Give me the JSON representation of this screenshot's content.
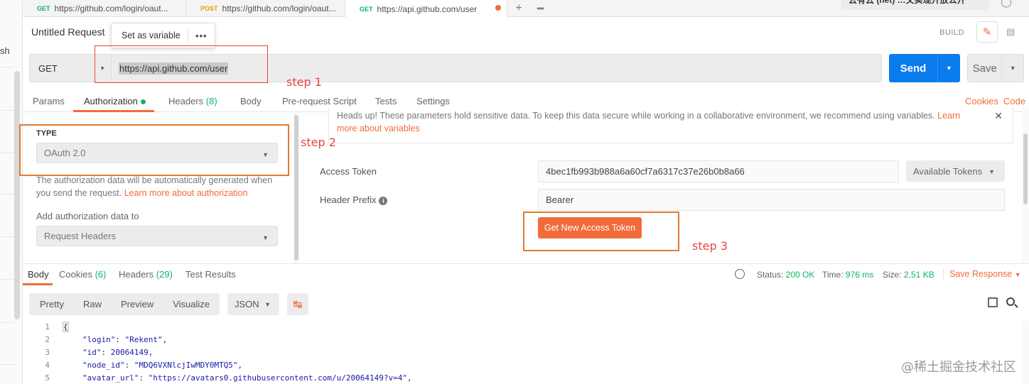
{
  "tabs": [
    {
      "method": "GET",
      "url": "https://github.com/login/oaut..."
    },
    {
      "method": "POST",
      "url": "https://github.com/login/oaut..."
    },
    {
      "method": "GET",
      "url": "https://api.github.com/user"
    }
  ],
  "left_sidebar": {
    "fragment": "sh"
  },
  "environment": {
    "label": "云有云 (net) …文实现开放公开"
  },
  "request": {
    "name": "Untitled Request",
    "method": "GET",
    "url": "https://api.github.com/user",
    "build_label": "BUILD",
    "send_label": "Send",
    "save_label": "Save"
  },
  "popup": {
    "set_as_variable": "Set as variable",
    "more": "•••"
  },
  "annotations": {
    "step1": "step 1",
    "step2": "step 2",
    "step3": "step 3"
  },
  "request_tabs": {
    "params": "Params",
    "authorization": "Authorization",
    "headers": "Headers",
    "headers_count": "(8)",
    "body": "Body",
    "prerequest": "Pre-request Script",
    "tests": "Tests",
    "settings": "Settings",
    "cookies": "Cookies",
    "code": "Code"
  },
  "auth": {
    "type_label": "TYPE",
    "type_value": "OAuth 2.0",
    "description": "The authorization data will be automatically generated when you send the request.",
    "learn_more": "Learn more about authorization",
    "add_to_label": "Add authorization data to",
    "add_to_value": "Request Headers",
    "heads_up": "Heads up! These parameters hold sensitive data. To keep this data secure while working in a collaborative environment, we recommend using variables.",
    "learn_more_vars_1": "Learn more",
    "learn_more_vars_2": "about variables",
    "access_token_label": "Access Token",
    "access_token_value": "4bec1fb993b988a6a60cf7a6317c37e26b0b8a66",
    "available_tokens": "Available Tokens",
    "header_prefix_label": "Header Prefix",
    "header_prefix_value": "Bearer",
    "get_token_button": "Get New Access Token"
  },
  "response": {
    "tabs": {
      "body": "Body",
      "cookies": "Cookies",
      "cookies_count": "(6)",
      "headers": "Headers",
      "headers_count": "(29)",
      "test_results": "Test Results"
    },
    "status_label": "Status:",
    "status_value": "200 OK",
    "time_label": "Time:",
    "time_value": "976 ms",
    "size_label": "Size:",
    "size_value": "2.51 KB",
    "save_response": "Save Response",
    "views": [
      "Pretty",
      "Raw",
      "Preview",
      "Visualize"
    ],
    "format": "JSON",
    "code_lines": [
      {
        "n": "1",
        "text": "{"
      },
      {
        "n": "2",
        "key": "\"login\"",
        "val": "\"Rekent\","
      },
      {
        "n": "3",
        "key": "\"id\"",
        "val": "20064149,"
      },
      {
        "n": "4",
        "key": "\"node_id\"",
        "val": "\"MDQ6VXNlcjIwMDY0MTQ5\","
      },
      {
        "n": "5",
        "key": "\"avatar_url\"",
        "val": "\"https://avatars0.githubusercontent.com/u/20064149?v=4\","
      }
    ]
  },
  "watermark": "@稀土掘金技术社区",
  "colors": {
    "accent": "#f26b3a",
    "send": "#097bed",
    "success": "#0cb566",
    "annotation_red": "#e64545",
    "annotation_orange": "#e27a2e"
  }
}
